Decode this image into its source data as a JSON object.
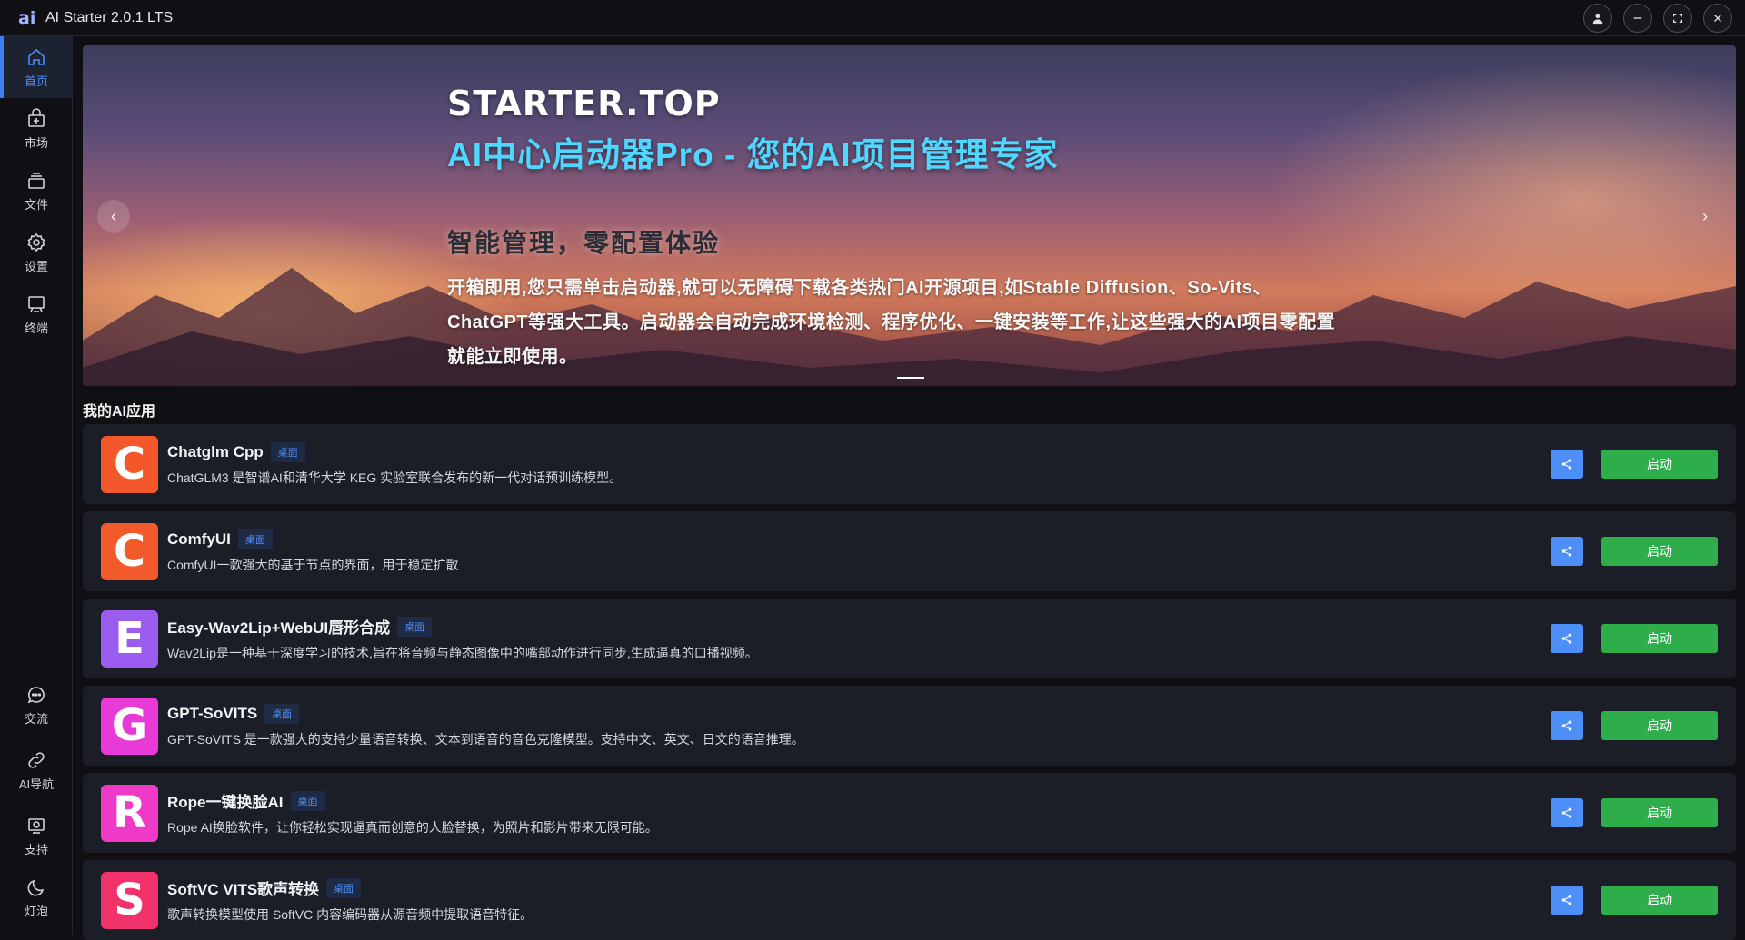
{
  "window": {
    "title": "AI Starter 2.0.1 LTS",
    "logo_text": "ai",
    "controls": [
      "user-icon",
      "minimize-icon",
      "maximize-icon",
      "close-icon"
    ]
  },
  "sidebar": {
    "top_items": [
      {
        "label": "首页",
        "icon": "home-icon",
        "active": true
      },
      {
        "label": "市场",
        "icon": "store-icon",
        "active": false
      },
      {
        "label": "文件",
        "icon": "files-icon",
        "active": false
      },
      {
        "label": "设置",
        "icon": "gear-icon",
        "active": false
      },
      {
        "label": "终端",
        "icon": "terminal-icon",
        "active": false
      }
    ],
    "bottom_items": [
      {
        "label": "交流",
        "icon": "chat-icon"
      },
      {
        "label": "AI导航",
        "icon": "link-icon"
      },
      {
        "label": "支持",
        "icon": "support-icon"
      },
      {
        "label": "灯泡",
        "icon": "moon-icon"
      }
    ]
  },
  "banner": {
    "brand": "STARTER.TOP",
    "headline": "AI中心启动器Pro - 您的AI项目管理专家",
    "subheadline": "智能管理，零配置体验",
    "description": "开箱即用,您只需单击启动器,就可以无障碍下载各类热门AI开源项目,如Stable Diffusion、So-Vits、ChatGPT等强大工具。启动器会自动完成环境检测、程序优化、一键安装等工作,让这些强大的AI项目零配置就能立即使用。"
  },
  "section": {
    "title": "我的AI应用"
  },
  "apps": [
    {
      "letter": "C",
      "color": "#f2582a",
      "name": "Chatglm Cpp",
      "tag": "桌面",
      "desc": "ChatGLM3 是智谱AI和清华大学 KEG 实验室联合发布的新一代对话预训练模型。",
      "share_icon": "share-icon",
      "launch_label": "启动"
    },
    {
      "letter": "C",
      "color": "#f25a2b",
      "name": "ComfyUI",
      "tag": "桌面",
      "desc": "ComfyUI一款强大的基于节点的界面，用于稳定扩散",
      "share_icon": "share-icon",
      "launch_label": "启动"
    },
    {
      "letter": "E",
      "color": "#9b5cf0",
      "name": "Easy-Wav2Lip+WebUI唇形合成",
      "tag": "桌面",
      "desc": "Wav2Lip是一种基于深度学习的技术,旨在将音频与静态图像中的嘴部动作进行同步,生成逼真的口播视频。",
      "share_icon": "share-icon",
      "launch_label": "启动"
    },
    {
      "letter": "G",
      "color": "#e83ad6",
      "name": "GPT-SoVITS",
      "tag": "桌面",
      "desc": "GPT-SoVITS 是一款强大的支持少量语音转换、文本到语音的音色克隆模型。支持中文、英文、日文的语音推理。",
      "share_icon": "share-icon",
      "launch_label": "启动"
    },
    {
      "letter": "R",
      "color": "#ee3ac7",
      "name": "Rope一键换脸AI",
      "tag": "桌面",
      "desc": "Rope AI换脸软件，让你轻松实现逼真而创意的人脸替换，为照片和影片带来无限可能。",
      "share_icon": "share-icon",
      "launch_label": "启动"
    },
    {
      "letter": "S",
      "color": "#f2336b",
      "name": "SoftVC VITS歌声转换",
      "tag": "桌面",
      "desc": "歌声转换模型使用 SoftVC 内容编码器从源音频中提取语音特征。",
      "share_icon": "share-icon",
      "launch_label": "启动"
    }
  ]
}
